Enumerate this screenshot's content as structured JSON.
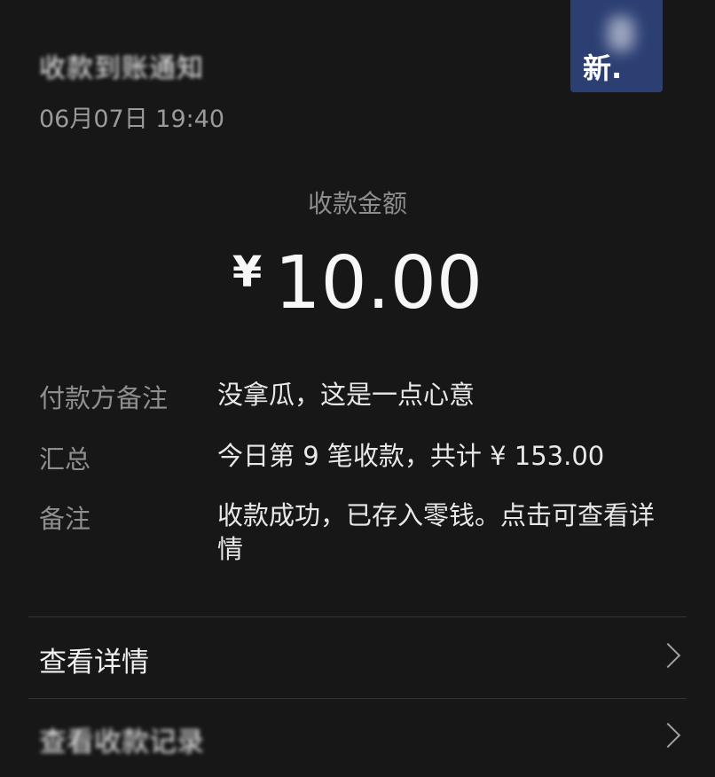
{
  "notification": {
    "title": "收款到账通知",
    "time": "06月07日 19:40",
    "avatar_text": "新."
  },
  "amount": {
    "label": "收款金额",
    "currency": "¥",
    "value": "10.00"
  },
  "details": {
    "payer_note_label": "付款方备注",
    "payer_note_value": "没拿瓜，这是一点心意",
    "summary_label": "汇总",
    "summary_value": "今日第 9 笔收款，共计 ¥ 153.00",
    "remark_label": "备注",
    "remark_value": "收款成功，已存入零钱。点击可查看详情"
  },
  "menu": {
    "view_details": "查看详情",
    "second_item": "查看收款记录"
  },
  "icons": {
    "chevron": "chevron-right-icon"
  }
}
